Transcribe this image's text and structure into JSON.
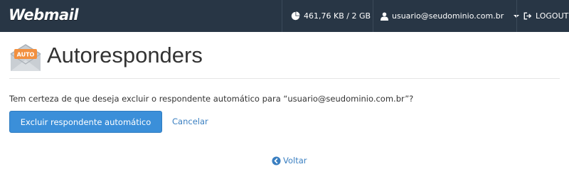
{
  "topbar": {
    "logo": "Webmail",
    "quota": "461,76 KB / 2 GB",
    "user": "usuario@seudominio.com.br",
    "logout": "LOGOUT"
  },
  "page": {
    "icon_label": "AUTO",
    "title": "Autoresponders",
    "confirm_text": "Tem certeza de que deseja excluir o respondente automático para “usuario@seudominio.com.br”?",
    "delete_button": "Excluir respondente automático",
    "cancel_link": "Cancelar",
    "back_link": "Voltar"
  },
  "colors": {
    "topbar": "#283645",
    "primary": "#3b8fd9",
    "link": "#3a7fc1"
  }
}
